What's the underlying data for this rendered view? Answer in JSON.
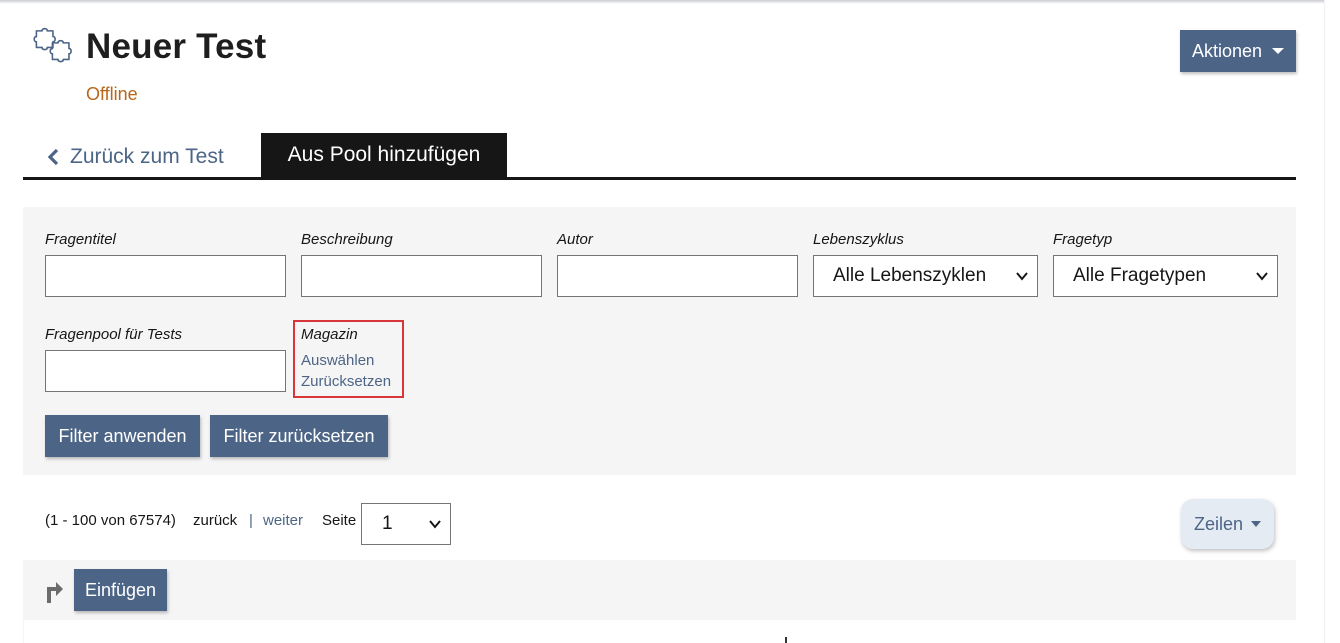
{
  "header": {
    "title": "Neuer Test",
    "status": "Offline",
    "actions_label": "Aktionen"
  },
  "tabs": {
    "back_label": "Zurück zum Test",
    "active_label": "Aus Pool hinzufügen"
  },
  "filter": {
    "fields": [
      {
        "label": "Fragentitel",
        "value": ""
      },
      {
        "label": "Beschreibung",
        "value": ""
      },
      {
        "label": "Autor",
        "value": ""
      },
      {
        "label": "Lebenszyklus",
        "selected": "Alle Lebenszyklen"
      },
      {
        "label": "Fragetyp",
        "selected": "Alle Fragetypen"
      },
      {
        "label": "Fragenpool für Tests",
        "value": ""
      }
    ],
    "magazin": {
      "label": "Magazin",
      "select_link": "Auswählen",
      "reset_link": "Zurücksetzen"
    },
    "apply_label": "Filter anwenden",
    "reset_label": "Filter zurücksetzen"
  },
  "pagination": {
    "range": "(1 - 100 von 67574)",
    "prev": "zurück",
    "separator": "|",
    "next": "weiter",
    "page_label": "Seite",
    "page_value": "1",
    "rows_label": "Zeilen"
  },
  "toolbar": {
    "insert_label": "Einfügen"
  },
  "icons": {
    "title_icon": "puzzle-icon",
    "back_icon": "chevron-left-icon",
    "toolbar_icon": "turn-right-arrow-icon"
  },
  "colors": {
    "accent": "#4c6586",
    "status": "#b8661a",
    "highlight_border": "#d9363a"
  }
}
